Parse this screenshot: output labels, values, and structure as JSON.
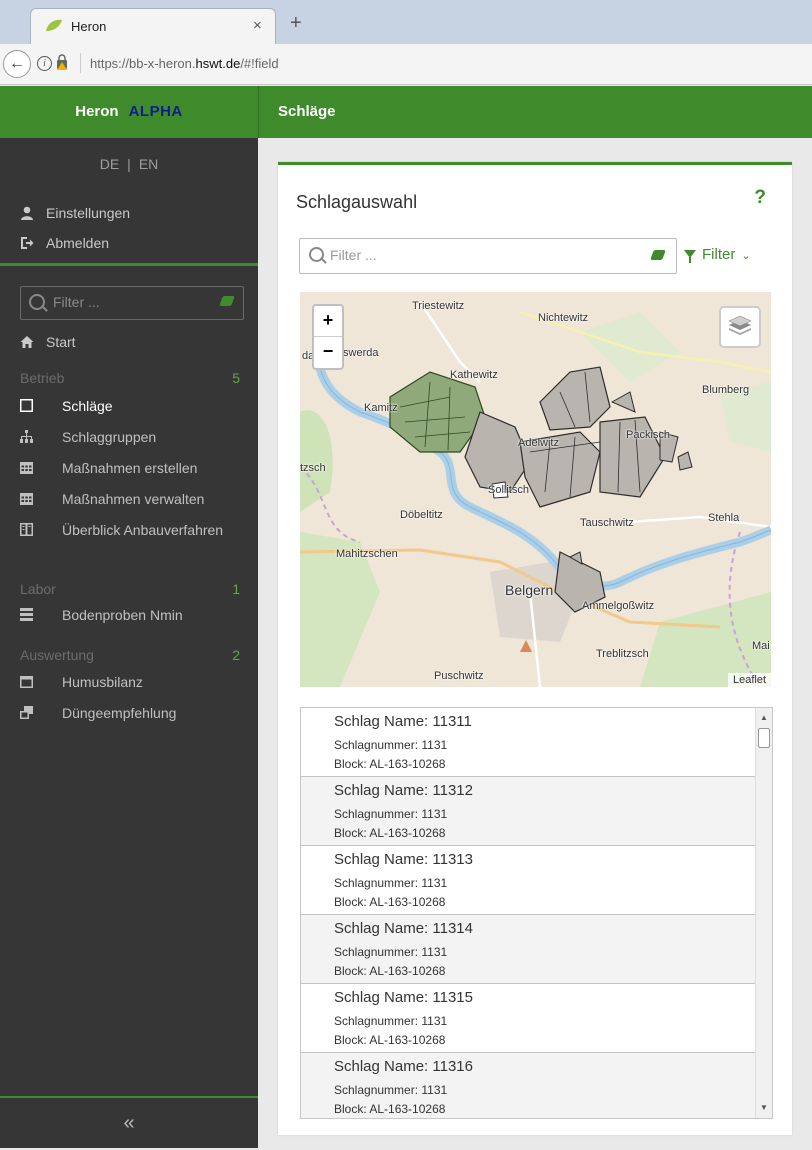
{
  "browser": {
    "tab_title": "Heron",
    "tab_close": "×",
    "new_tab": "+",
    "url_prefix": "https://bb-x-heron.",
    "url_domain": "hswt.de",
    "url_suffix": "/#!field"
  },
  "header": {
    "brand": "Heron",
    "brand_badge": "ALPHA",
    "page_title": "Schläge",
    "brand_color": "#3f8b2b"
  },
  "sidebar": {
    "lang_de": "DE",
    "lang_sep": "|",
    "lang_en": "EN",
    "settings": "Einstellungen",
    "logout": "Abmelden",
    "filter_placeholder": "Filter ...",
    "start": "Start",
    "sections": [
      {
        "name": "Betrieb",
        "count": "5",
        "items": [
          {
            "label": "Schläge",
            "icon": "square-icon"
          },
          {
            "label": "Schlaggruppen",
            "icon": "sitemap-icon"
          },
          {
            "label": "Maßnahmen erstellen",
            "icon": "calendar-icon"
          },
          {
            "label": "Maßnahmen verwalten",
            "icon": "calendar-icon"
          },
          {
            "label": "Überblick Anbauverfahren",
            "icon": "table-icon"
          }
        ]
      },
      {
        "name": "Labor",
        "count": "1",
        "items": [
          {
            "label": "Bodenproben Nmin",
            "icon": "list-icon"
          }
        ]
      },
      {
        "name": "Auswertung",
        "count": "2",
        "items": [
          {
            "label": "Humusbilanz",
            "icon": "calendar-icon"
          },
          {
            "label": "Düngeempfehlung",
            "icon": "copy-icon"
          }
        ]
      }
    ],
    "collapse": "«"
  },
  "panel": {
    "title": "Schlagauswahl",
    "help": "?",
    "search_placeholder": "Filter ...",
    "filter_label": "Filter",
    "chevron": "⌄"
  },
  "map": {
    "zoom_in": "+",
    "zoom_out": "−",
    "attribution": "Leaflet",
    "labels": {
      "triestewitz": "Triestewitz",
      "nichtewitz": "Nichtewitz",
      "iswerda": "Iswerda",
      "da": "da",
      "kathewitz": "Kathewitz",
      "blumberg": "Blumberg",
      "kamitz": "Kamitz",
      "adelwitz": "Adelwitz",
      "packisch": "Packisch",
      "tzsch": "tzsch",
      "sollitsch": "Sollitsch",
      "doebeltitz": "Döbeltitz",
      "tauschwitz": "Tauschwitz",
      "stehla": "Stehla",
      "mahitzschen": "Mahitzschen",
      "belgern": "Belgern",
      "ammelgosswitz": "Ammelgoßwitz",
      "mai": "Mai",
      "treblitzsch": "Treblitzsch",
      "puschwitz": "Puschwitz"
    }
  },
  "fields": [
    {
      "name": "Schlag Name: 11311",
      "number": "Schlagnummer: 1131",
      "block": "Block: AL-163-10268"
    },
    {
      "name": "Schlag Name: 11312",
      "number": "Schlagnummer: 1131",
      "block": "Block: AL-163-10268"
    },
    {
      "name": "Schlag Name: 11313",
      "number": "Schlagnummer: 1131",
      "block": "Block: AL-163-10268"
    },
    {
      "name": "Schlag Name: 11314",
      "number": "Schlagnummer: 1131",
      "block": "Block: AL-163-10268"
    },
    {
      "name": "Schlag Name: 11315",
      "number": "Schlagnummer: 1131",
      "block": "Block: AL-163-10268"
    },
    {
      "name": "Schlag Name: 11316",
      "number": "Schlagnummer: 1131",
      "block": "Block: AL-163-10268"
    }
  ]
}
